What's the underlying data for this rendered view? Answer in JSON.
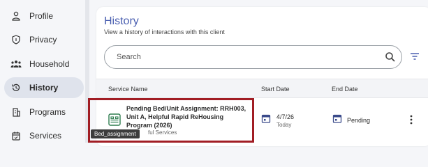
{
  "sidebar": {
    "items": [
      {
        "label": "Profile",
        "icon": "person-icon",
        "active": false
      },
      {
        "label": "Privacy",
        "icon": "shield-icon",
        "active": false
      },
      {
        "label": "Household",
        "icon": "group-icon",
        "active": false
      },
      {
        "label": "History",
        "icon": "history-icon",
        "active": true
      },
      {
        "label": "Programs",
        "icon": "building-icon",
        "active": false
      },
      {
        "label": "Services",
        "icon": "calendar-check-icon",
        "active": false
      }
    ]
  },
  "main": {
    "title": "History",
    "subtitle": "View a history of interactions with this client",
    "search": {
      "placeholder": "Search"
    },
    "table": {
      "headers": {
        "service": "Service Name",
        "start": "Start Date",
        "end": "End Date"
      },
      "rows": [
        {
          "service_name": "Pending Bed/Unit Assignment: RRH003, Unit A, Helpful Rapid ReHousing Program (2026)",
          "service_sub": "ful Services",
          "start_date": "4/7/26",
          "start_relative": "Today",
          "end_date": "Pending"
        }
      ]
    },
    "tooltip": "Bed_assignment"
  },
  "colors": {
    "accent": "#4a5fb0",
    "bed_icon": "#2e7d4f",
    "highlight": "#a11d24",
    "calendar_icon": "#3a4a8a"
  }
}
